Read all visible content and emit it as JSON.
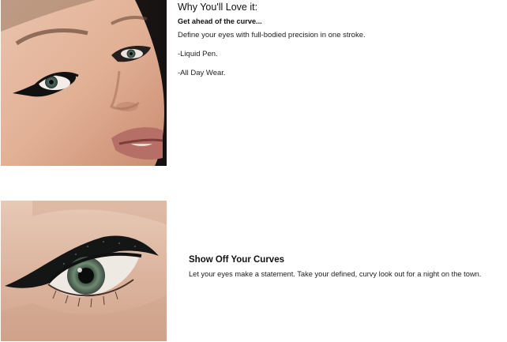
{
  "section_top": {
    "heading": "Why You'll Love it:",
    "subheading": "Get ahead of the curve...",
    "lines": [
      "Define your eyes with full-bodied precision in one stroke.",
      "-Liquid Pen.",
      "-All Day Wear."
    ],
    "image_name": "model-face-eyeliner-image"
  },
  "section_bottom": {
    "heading": "Show Off Your Curves",
    "body": "Let your eyes make a statement. Take your defined, curvy look out for a night on the town.",
    "image_name": "eye-closeup-eyeliner-image"
  }
}
